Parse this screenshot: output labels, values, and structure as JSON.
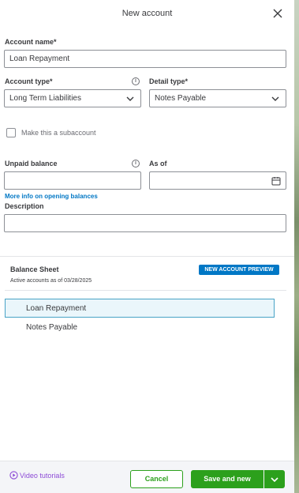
{
  "header": {
    "title": "New account",
    "close_icon": "close-icon"
  },
  "form": {
    "account_name": {
      "label": "Account name*",
      "value": "Loan Repayment"
    },
    "account_type": {
      "label": "Account type*",
      "value": "Long Term Liabilities"
    },
    "detail_type": {
      "label": "Detail type*",
      "value": "Notes Payable"
    },
    "subaccount": {
      "label": "Make this a subaccount",
      "checked": false
    },
    "unpaid_balance": {
      "label": "Unpaid balance",
      "value": ""
    },
    "as_of": {
      "label": "As of",
      "value": ""
    },
    "more_info_link": "More info on opening balances",
    "description": {
      "label": "Description",
      "value": ""
    }
  },
  "preview": {
    "title": "Balance Sheet",
    "subtitle": "Active accounts as of 03/28/2025",
    "badge": "NEW ACCOUNT PREVIEW",
    "items": [
      "Loan Repayment",
      "Notes Payable"
    ]
  },
  "footer": {
    "video_tutorials": "Video tutorials",
    "cancel": "Cancel",
    "save_and_new": "Save and new"
  },
  "colors": {
    "accent_green": "#2ca01c",
    "link_blue": "#0077c5",
    "badge_blue": "#0077c5",
    "video_purple": "#8d4bd6"
  }
}
